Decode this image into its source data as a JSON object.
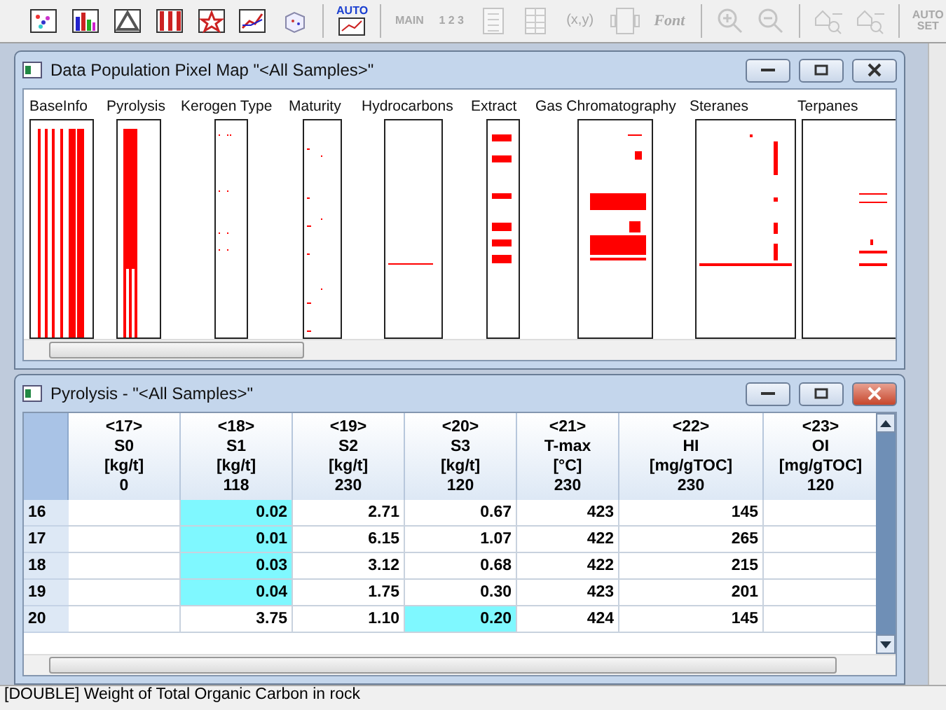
{
  "toolbar": [
    {
      "kind": "scatter",
      "disabled": false
    },
    {
      "kind": "bars",
      "disabled": false
    },
    {
      "kind": "ternary",
      "disabled": false
    },
    {
      "kind": "strips",
      "disabled": false
    },
    {
      "kind": "star",
      "disabled": false
    },
    {
      "kind": "lines",
      "disabled": false
    },
    {
      "kind": "cube",
      "disabled": false
    },
    {
      "kind": "sep"
    },
    {
      "kind": "auto",
      "label": "AUTO",
      "disabled": false
    },
    {
      "kind": "sep"
    },
    {
      "kind": "main",
      "label": "MAIN",
      "disabled": true
    },
    {
      "kind": "numbers",
      "label": "1 2 3",
      "disabled": true
    },
    {
      "kind": "list",
      "disabled": true
    },
    {
      "kind": "grid",
      "disabled": true
    },
    {
      "kind": "xy",
      "label": "(x,y)",
      "disabled": true
    },
    {
      "kind": "frame",
      "disabled": true
    },
    {
      "kind": "font",
      "label": "Font",
      "disabled": true
    },
    {
      "kind": "sep"
    },
    {
      "kind": "zoomin",
      "disabled": true
    },
    {
      "kind": "zoomout",
      "disabled": true
    },
    {
      "kind": "sep"
    },
    {
      "kind": "home1",
      "disabled": true
    },
    {
      "kind": "home2",
      "disabled": true
    },
    {
      "kind": "sep"
    },
    {
      "kind": "autoset",
      "label": "AUTO SET",
      "disabled": true
    }
  ],
  "pixel_map": {
    "title": "Data Population Pixel Map \"<All Samples>\"",
    "groups": [
      "BaseInfo",
      "Pyrolysis",
      "Kerogen Type",
      "Maturity",
      "Hydrocarbons",
      "Extract",
      "Gas Chromatography",
      "Steranes",
      "Terpanes"
    ]
  },
  "pyrolysis": {
    "title": "Pyrolysis - \"<All Samples>\"",
    "columns": [
      {
        "index": "<17>",
        "name": "S0",
        "unit": "[kg/t]",
        "count": "0"
      },
      {
        "index": "<18>",
        "name": "S1",
        "unit": "[kg/t]",
        "count": "118"
      },
      {
        "index": "<19>",
        "name": "S2",
        "unit": "[kg/t]",
        "count": "230"
      },
      {
        "index": "<20>",
        "name": "S3",
        "unit": "[kg/t]",
        "count": "120"
      },
      {
        "index": "<21>",
        "name": "T-max",
        "unit": "[°C]",
        "count": "230"
      },
      {
        "index": "<22>",
        "name": "HI",
        "unit": "[mg/gTOC]",
        "count": "230"
      },
      {
        "index": "<23>",
        "name": "OI",
        "unit": "[mg/gTOC]",
        "count": "120"
      }
    ],
    "rows": [
      {
        "num": "16",
        "cells": [
          {
            "text": "",
            "highlighted": false
          },
          {
            "text": "0.02",
            "highlighted": true
          },
          {
            "text": "2.71",
            "highlighted": false
          },
          {
            "text": "0.67",
            "highlighted": false
          },
          {
            "text": "423",
            "highlighted": false
          },
          {
            "text": "145",
            "highlighted": false
          },
          {
            "text": "",
            "highlighted": false
          }
        ]
      },
      {
        "num": "17",
        "cells": [
          {
            "text": "",
            "highlighted": false
          },
          {
            "text": "0.01",
            "highlighted": true
          },
          {
            "text": "6.15",
            "highlighted": false
          },
          {
            "text": "1.07",
            "highlighted": false
          },
          {
            "text": "422",
            "highlighted": false
          },
          {
            "text": "265",
            "highlighted": false
          },
          {
            "text": "",
            "highlighted": false
          }
        ]
      },
      {
        "num": "18",
        "cells": [
          {
            "text": "",
            "highlighted": false
          },
          {
            "text": "0.03",
            "highlighted": true
          },
          {
            "text": "3.12",
            "highlighted": false
          },
          {
            "text": "0.68",
            "highlighted": false
          },
          {
            "text": "422",
            "highlighted": false
          },
          {
            "text": "215",
            "highlighted": false
          },
          {
            "text": "",
            "highlighted": false
          }
        ]
      },
      {
        "num": "19",
        "cells": [
          {
            "text": "",
            "highlighted": false
          },
          {
            "text": "0.04",
            "highlighted": true
          },
          {
            "text": "1.75",
            "highlighted": false
          },
          {
            "text": "0.30",
            "highlighted": false
          },
          {
            "text": "423",
            "highlighted": false
          },
          {
            "text": "201",
            "highlighted": false
          },
          {
            "text": "",
            "highlighted": false
          }
        ]
      },
      {
        "num": "20",
        "cells": [
          {
            "text": "",
            "highlighted": false
          },
          {
            "text": "3.75",
            "highlighted": false
          },
          {
            "text": "1.10",
            "highlighted": false
          },
          {
            "text": "0.20",
            "highlighted": true
          },
          {
            "text": "424",
            "highlighted": false
          },
          {
            "text": "145",
            "highlighted": false
          },
          {
            "text": "",
            "highlighted": false
          }
        ]
      }
    ]
  },
  "status_bar": "[DOUBLE] Weight of Total Organic Carbon in rock"
}
